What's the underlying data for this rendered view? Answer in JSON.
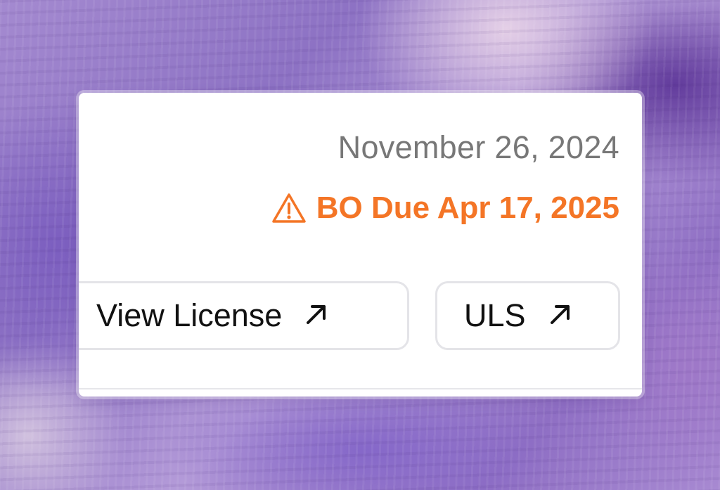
{
  "card": {
    "date": "November 26, 2024",
    "due_notice": "BO Due Apr 17, 2025"
  },
  "buttons": {
    "view_license": "View License",
    "uls": "ULS"
  },
  "icons": {
    "warning": "warning-triangle-icon",
    "external": "arrow-up-right-icon"
  },
  "colors": {
    "accent_orange": "#f47526",
    "date_gray": "#777777"
  }
}
